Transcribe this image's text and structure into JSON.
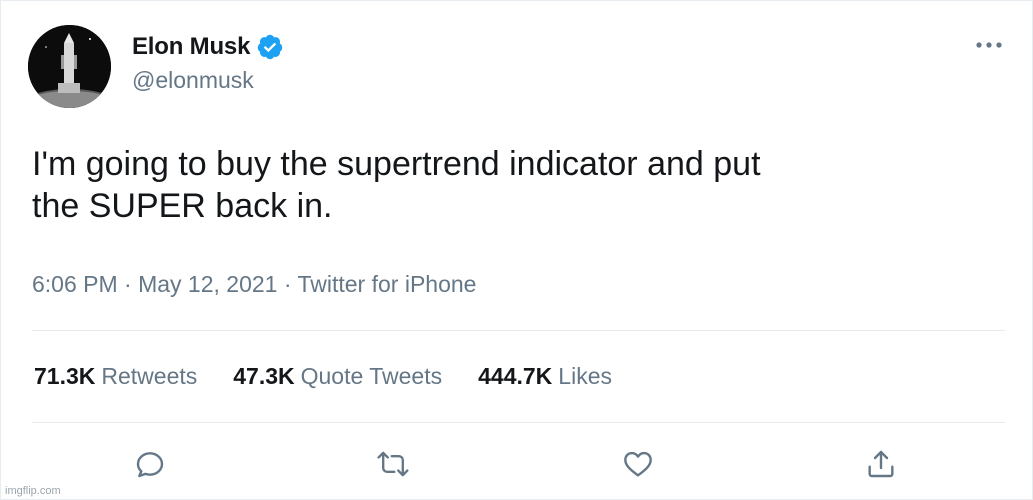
{
  "user": {
    "name": "Elon Musk",
    "handle": "@elonmusk",
    "verified": true
  },
  "tweet": {
    "text": "I'm going to buy the supertrend indicator and put the SUPER back in.",
    "time": "6:06 PM",
    "date": "May 12, 2021",
    "source": "Twitter for iPhone",
    "meta_line": "6:06 PM · May 12, 2021 · Twitter for iPhone"
  },
  "stats": {
    "retweets": {
      "count": "71.3K",
      "label": "Retweets"
    },
    "quotes": {
      "count": "47.3K",
      "label": "Quote Tweets"
    },
    "likes": {
      "count": "444.7K",
      "label": "Likes"
    }
  },
  "actions": {
    "icons": [
      "reply-icon",
      "retweet-icon",
      "like-icon",
      "share-icon"
    ]
  },
  "watermark": "imgflip.com",
  "colors": {
    "verified_blue": "#1da1f2",
    "secondary_text": "#657786",
    "primary_text": "#14171a",
    "divider": "#e6ecf0"
  }
}
